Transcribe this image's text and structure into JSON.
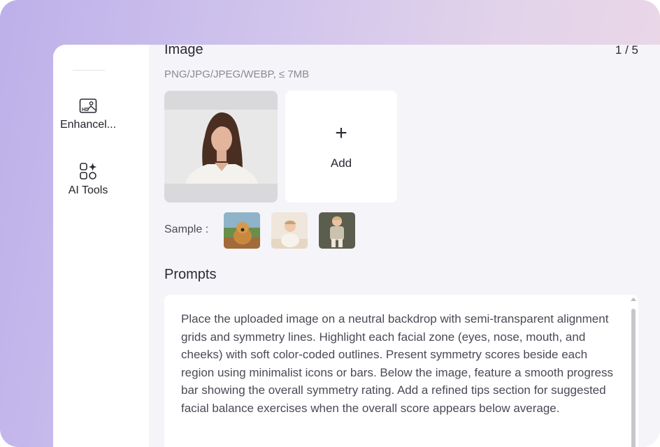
{
  "sidebar": {
    "items": [
      {
        "label": "Enhancel...",
        "icon": "hd-image-icon"
      },
      {
        "label": "AI Tools",
        "icon": "ai-tools-icon"
      }
    ]
  },
  "image_section": {
    "title": "Image",
    "counter": "1 / 5",
    "formats": "PNG/JPG/JPEG/WEBP, ≤ 7MB",
    "add_label": "Add",
    "add_icon": "+"
  },
  "samples": {
    "label": "Sample :",
    "items": [
      "dog-sample",
      "baby-sample",
      "toddler-sample"
    ]
  },
  "prompts": {
    "title": "Prompts",
    "text": "Place the uploaded image on a neutral backdrop with semi-transparent alignment grids and symmetry lines. Highlight each facial zone (eyes, nose, mouth, and cheeks) with soft color-coded outlines. Present symmetry scores beside each region using minimalist icons or bars. Below the image, feature a smooth progress bar showing the overall symmetry rating. Add a refined tips section for suggested facial balance exercises when the overall score appears below average."
  },
  "colors": {
    "gradient_start": "#bdb0ea",
    "gradient_end": "#ecd9e6",
    "main_bg": "#f5f4f9",
    "text": "#2a2a33"
  }
}
